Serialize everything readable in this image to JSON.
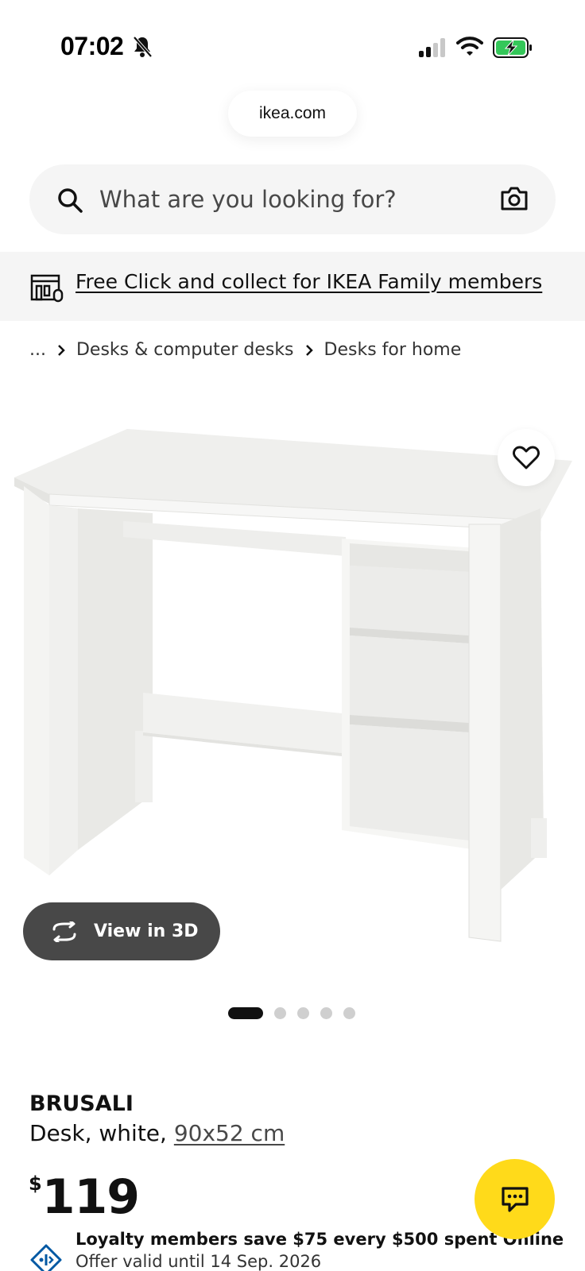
{
  "status_bar": {
    "time": "07:02",
    "icons": [
      "bell-slash-icon",
      "signal-icon",
      "wifi-icon",
      "battery-charging-icon"
    ],
    "battery_color": "#34c759"
  },
  "browser": {
    "url": "ikea.com"
  },
  "search": {
    "placeholder": "What are you looking for?",
    "icon": "search-icon",
    "camera_icon": "camera-icon"
  },
  "promo": {
    "icon": "store-icon",
    "text": "Free Click and collect for IKEA Family members"
  },
  "breadcrumb": {
    "ellipsis": "...",
    "items": [
      "Desks & computer desks",
      "Desks for home"
    ]
  },
  "gallery": {
    "image_alt": "white desk with shelves",
    "favorite_icon": "heart-icon",
    "view3d_icon": "rotate-3d-icon",
    "view3d_label": "View in 3D",
    "slide_count": 5,
    "active_slide": 1
  },
  "product": {
    "name": "BRUSALI",
    "description": "Desk, white, ",
    "size": "90x52 cm",
    "currency": "$",
    "price": "119"
  },
  "loyalty": {
    "icon": "tag-icon",
    "text": "Loyalty members save $75 every $500 spent Online",
    "sub": "Offer valid until 14 Sep. 2026",
    "icon_color": "#0058a3"
  },
  "chat": {
    "icon": "chat-icon",
    "color": "#ffda1a"
  }
}
